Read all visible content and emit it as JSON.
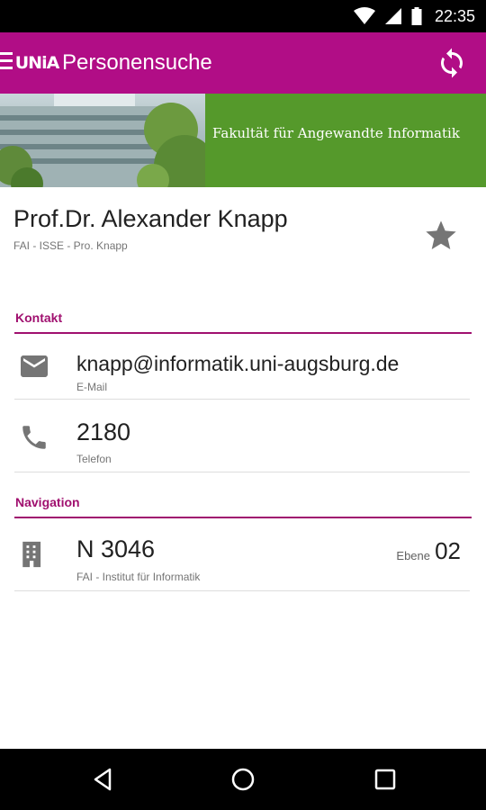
{
  "status_bar": {
    "time": "22:35",
    "icons": [
      "wifi-icon",
      "signal-icon",
      "battery-icon"
    ]
  },
  "app_bar": {
    "logo_text": "UNiA",
    "title": "Personensuche",
    "icons": [
      "menu-icon",
      "refresh-icon"
    ]
  },
  "banner": {
    "text": "Fakultät für Angewandte Informatik"
  },
  "person": {
    "name": "Prof.Dr. Alexander Knapp",
    "subtitle": "FAI - ISSE - Pro. Knapp",
    "favorite_icon": "star-icon"
  },
  "sections": {
    "contact": {
      "title": "Kontakt",
      "email": {
        "value": "knapp@informatik.uni-augsburg.de",
        "label": "E-Mail",
        "icon": "email-icon"
      },
      "phone": {
        "value": "2180",
        "label": "Telefon",
        "icon": "phone-icon"
      }
    },
    "navigation": {
      "title": "Navigation",
      "room": {
        "value": "N 3046",
        "label": "FAI - Institut für Informatik",
        "level_label": "Ebene",
        "level_value": "02",
        "icon": "building-icon"
      }
    }
  },
  "colors": {
    "primary": "#b10d86",
    "accent": "#a0106f",
    "banner_green": "#55992b"
  },
  "nav_bar": {
    "icons": [
      "back-icon",
      "home-icon",
      "recents-icon"
    ]
  }
}
